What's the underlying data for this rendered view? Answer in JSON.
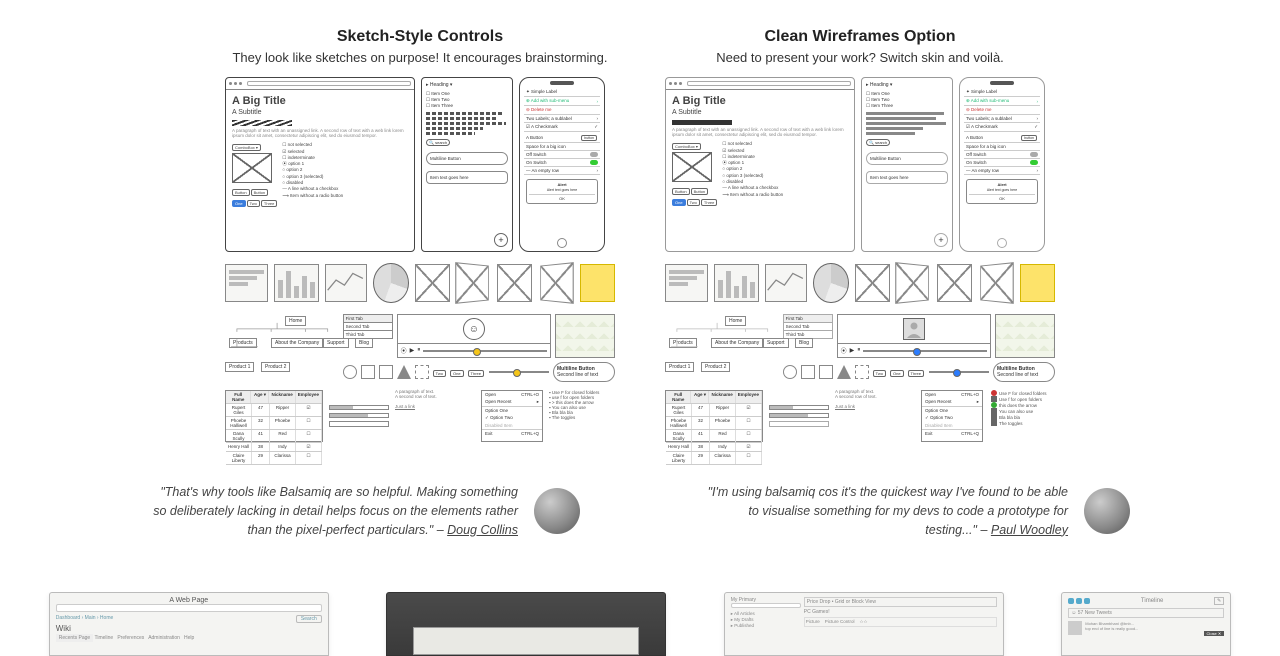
{
  "left": {
    "heading": "Sketch-Style Controls",
    "sub": "They look like sketches on purpose! It encourages brainstorming."
  },
  "right": {
    "heading": "Clean Wireframes Option",
    "sub": "Need to present your work? Switch skin and voilà."
  },
  "wf": {
    "big_title": "A Big Title",
    "subtitle": "A Subtitle",
    "multiline_button": "Multiline Button",
    "alert": "Alert",
    "menu": {
      "open": "Open",
      "open_recent": "Open Recent",
      "shortcut": "CTRL+O"
    },
    "sitemap": {
      "home": "Home",
      "products": "Products",
      "about": "About the Company",
      "support": "Support",
      "blog": "Blog",
      "product1": "Product 1",
      "product2": "Product 2"
    }
  },
  "testimonials": [
    {
      "quote": "\"That's why tools like Balsamiq are so helpful. Making something so deliberately lacking in detail helps focus on the elements rather than the pixel-perfect particulars.\" – ",
      "author": "Doug Collins"
    },
    {
      "quote": "\"I'm using balsamiq cos it's the quickest way I've found to be able to visualise something for my devs to code a prototype for testing...\" – ",
      "author": "Paul Woodley"
    }
  ],
  "thumbs": {
    "t1_title": "A Web Page",
    "t1_body": "Wiki",
    "t3_title": "",
    "t4_title": "Timeline"
  }
}
